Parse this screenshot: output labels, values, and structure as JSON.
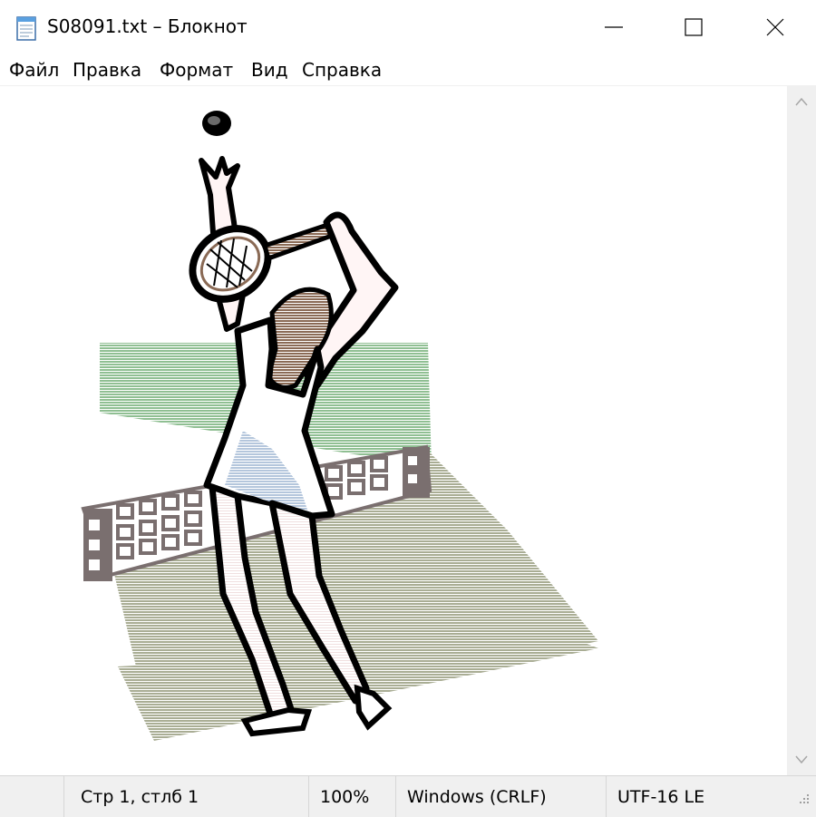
{
  "window": {
    "title": "S08091.txt – Блокнот",
    "app_icon": "notepad-icon",
    "controls": {
      "minimize_icon": "minimize-icon",
      "maximize_icon": "maximize-icon",
      "close_icon": "close-icon"
    }
  },
  "menu": {
    "items": [
      {
        "label": "Файл"
      },
      {
        "label": "Правка"
      },
      {
        "label": "Формат"
      },
      {
        "label": "Вид"
      },
      {
        "label": "Справка"
      }
    ]
  },
  "editor": {
    "content_description_icon": "tennis-player-clipart",
    "scroll_up_icon": "chevron-up-icon",
    "scroll_down_icon": "chevron-down-icon"
  },
  "statusbar": {
    "position": "Стр 1, стлб 1",
    "zoom": "100%",
    "line_endings": "Windows (CRLF)",
    "encoding": "UTF-16 LE",
    "grip_icon": "resize-grip-icon"
  },
  "colors": {
    "court_green": "#8fbf92",
    "court_gray": "#a9ad94",
    "net_gray": "#7a6f6f",
    "hair_brown": "#8a6a55",
    "dress_blue": "#b4c6dc",
    "outline": "#000000"
  }
}
